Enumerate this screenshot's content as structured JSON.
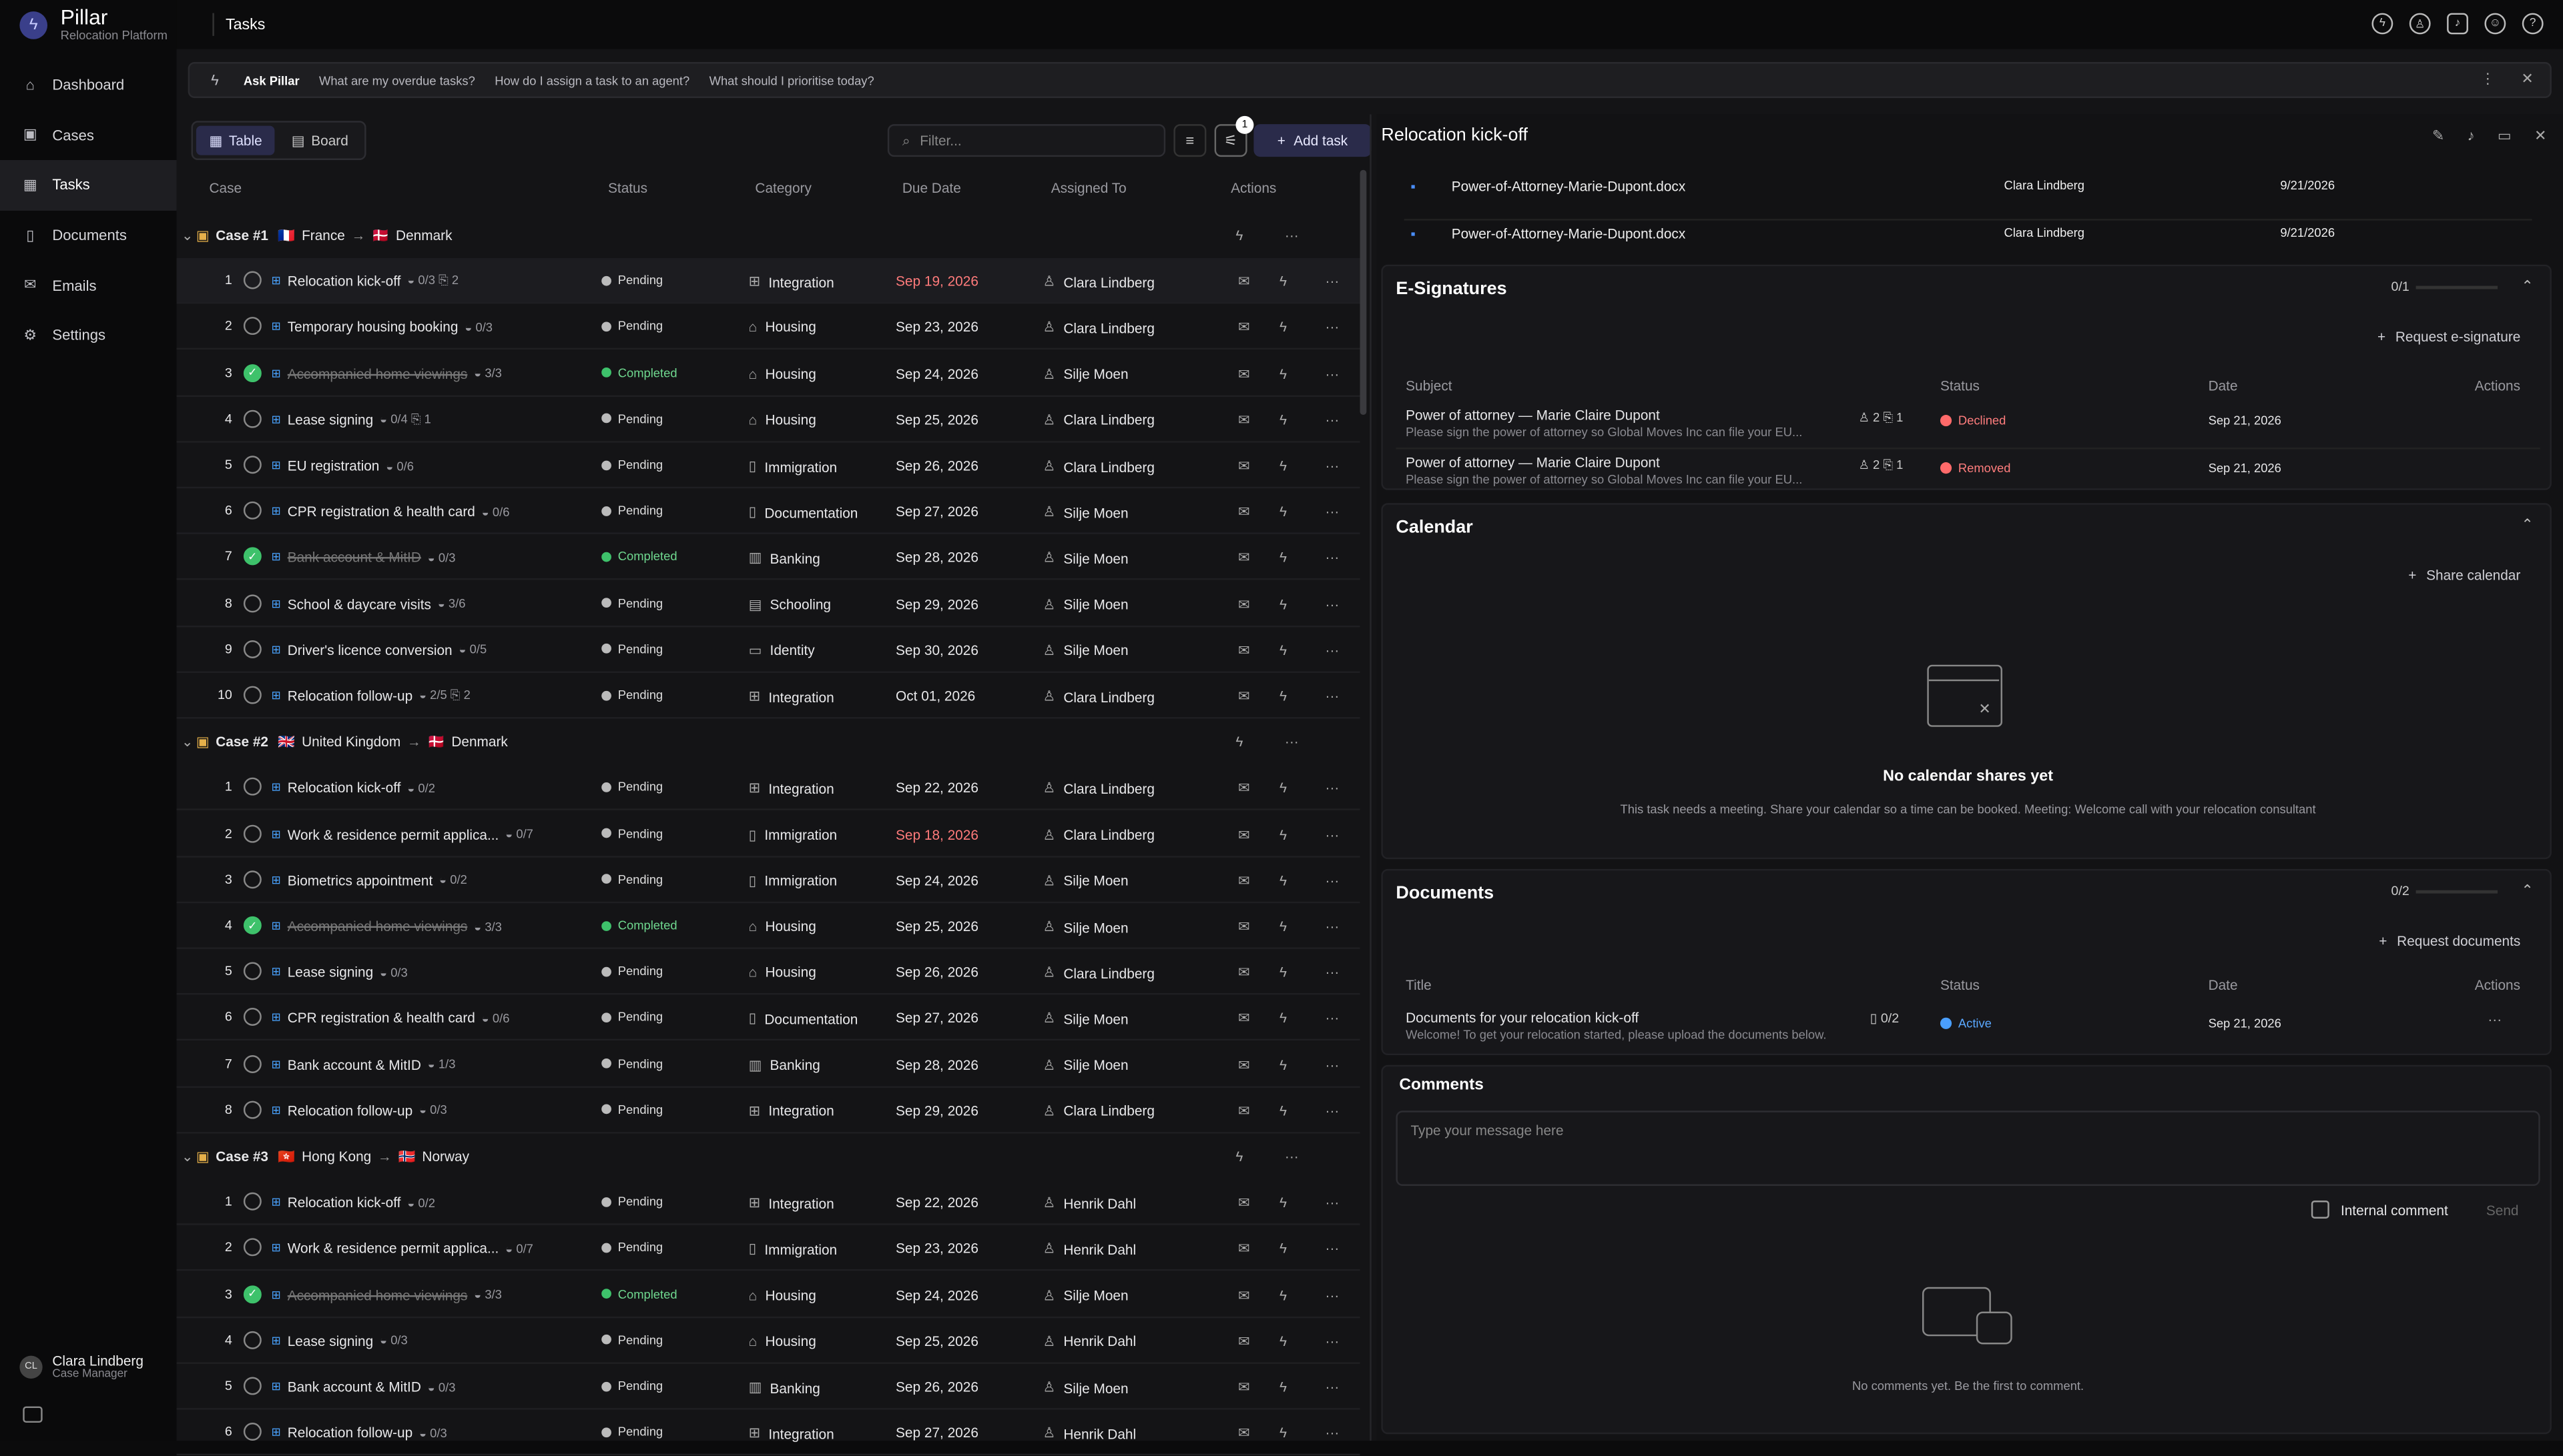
{
  "app": {
    "name": "Pillar",
    "subtitle": "Relocation Platform",
    "page_title": "Tasks"
  },
  "nav": [
    {
      "label": "Dashboard",
      "icon": "dashboard-icon"
    },
    {
      "label": "Cases",
      "icon": "briefcase-icon"
    },
    {
      "label": "Tasks",
      "icon": "tasks-icon",
      "active": true
    },
    {
      "label": "Documents",
      "icon": "document-icon"
    },
    {
      "label": "Emails",
      "icon": "mail-icon"
    },
    {
      "label": "Settings",
      "icon": "gear-icon"
    }
  ],
  "user": {
    "name": "Clara Lindberg",
    "role": "Case Manager",
    "initials": "CL"
  },
  "ask": {
    "title": "Ask Pillar",
    "suggestions": [
      "What are my overdue tasks?",
      "How do I assign a task to an agent?",
      "What should I prioritise today?"
    ]
  },
  "toolbar": {
    "view_table": "Table",
    "view_board": "Board",
    "filter_placeholder": "Filter...",
    "filter_badge": "1",
    "add_task": "Add task"
  },
  "columns": {
    "case": "Case",
    "status": "Status",
    "category": "Category",
    "due": "Due Date",
    "assigned": "Assigned To",
    "actions": "Actions"
  },
  "cases": [
    {
      "label": "Case #1",
      "from_flag": "🇫🇷",
      "from": "France",
      "to_flag": "🇩🇰",
      "to": "Denmark",
      "tasks": [
        {
          "n": "1",
          "name": "Relocation kick-off",
          "meta": "◒ 0/3  ⎘ 2",
          "status": "Pending",
          "category": "Integration",
          "due": "Sep 19, 2026",
          "over": true,
          "assignee": "Clara Lindberg",
          "sel": true
        },
        {
          "n": "2",
          "name": "Temporary housing booking",
          "meta": "◒ 0/3",
          "status": "Pending",
          "category": "Housing",
          "due": "Sep 23, 2026",
          "assignee": "Clara Lindberg"
        },
        {
          "n": "3",
          "name": "Accompanied home viewings",
          "meta": "◒ 3/3",
          "status": "Completed",
          "done": true,
          "category": "Housing",
          "due": "Sep 24, 2026",
          "assignee": "Silje Moen"
        },
        {
          "n": "4",
          "name": "Lease signing",
          "meta": "◒ 0/4  ⎘ 1",
          "status": "Pending",
          "category": "Housing",
          "due": "Sep 25, 2026",
          "assignee": "Clara Lindberg"
        },
        {
          "n": "5",
          "name": "EU registration",
          "meta": "◒ 0/6",
          "status": "Pending",
          "category": "Immigration",
          "due": "Sep 26, 2026",
          "assignee": "Clara Lindberg"
        },
        {
          "n": "6",
          "name": "CPR registration & health card",
          "meta": "◒ 0/6",
          "status": "Pending",
          "category": "Documentation",
          "due": "Sep 27, 2026",
          "assignee": "Silje Moen"
        },
        {
          "n": "7",
          "name": "Bank account & MitID",
          "meta": "◒ 0/3",
          "status": "Completed",
          "done": true,
          "category": "Banking",
          "due": "Sep 28, 2026",
          "assignee": "Silje Moen"
        },
        {
          "n": "8",
          "name": "School & daycare visits",
          "meta": "◒ 3/6",
          "status": "Pending",
          "category": "Schooling",
          "due": "Sep 29, 2026",
          "assignee": "Silje Moen"
        },
        {
          "n": "9",
          "name": "Driver's licence conversion",
          "meta": "◒ 0/5",
          "status": "Pending",
          "category": "Identity",
          "due": "Sep 30, 2026",
          "assignee": "Silje Moen"
        },
        {
          "n": "10",
          "name": "Relocation follow-up",
          "meta": "◒ 2/5  ⎘ 2",
          "status": "Pending",
          "category": "Integration",
          "due": "Oct 01, 2026",
          "assignee": "Clara Lindberg"
        }
      ]
    },
    {
      "label": "Case #2",
      "from_flag": "🇬🇧",
      "from": "United Kingdom",
      "to_flag": "🇩🇰",
      "to": "Denmark",
      "tasks": [
        {
          "n": "1",
          "name": "Relocation kick-off",
          "meta": "◒ 0/2",
          "status": "Pending",
          "category": "Integration",
          "due": "Sep 22, 2026",
          "assignee": "Clara Lindberg"
        },
        {
          "n": "2",
          "name": "Work & residence permit applica...",
          "meta": "◒ 0/7",
          "status": "Pending",
          "category": "Immigration",
          "due": "Sep 18, 2026",
          "over": true,
          "assignee": "Clara Lindberg"
        },
        {
          "n": "3",
          "name": "Biometrics appointment",
          "meta": "◒ 0/2",
          "status": "Pending",
          "category": "Immigration",
          "due": "Sep 24, 2026",
          "assignee": "Silje Moen"
        },
        {
          "n": "4",
          "name": "Accompanied home viewings",
          "meta": "◒ 3/3",
          "status": "Completed",
          "done": true,
          "category": "Housing",
          "due": "Sep 25, 2026",
          "assignee": "Silje Moen"
        },
        {
          "n": "5",
          "name": "Lease signing",
          "meta": "◒ 0/3",
          "status": "Pending",
          "category": "Housing",
          "due": "Sep 26, 2026",
          "assignee": "Clara Lindberg"
        },
        {
          "n": "6",
          "name": "CPR registration & health card",
          "meta": "◒ 0/6",
          "status": "Pending",
          "category": "Documentation",
          "due": "Sep 27, 2026",
          "assignee": "Silje Moen"
        },
        {
          "n": "7",
          "name": "Bank account & MitID",
          "meta": "◒ 1/3",
          "status": "Pending",
          "category": "Banking",
          "due": "Sep 28, 2026",
          "assignee": "Silje Moen"
        },
        {
          "n": "8",
          "name": "Relocation follow-up",
          "meta": "◒ 0/3",
          "status": "Pending",
          "category": "Integration",
          "due": "Sep 29, 2026",
          "assignee": "Clara Lindberg"
        }
      ]
    },
    {
      "label": "Case #3",
      "from_flag": "🇭🇰",
      "from": "Hong Kong",
      "to_flag": "🇳🇴",
      "to": "Norway",
      "tasks": [
        {
          "n": "1",
          "name": "Relocation kick-off",
          "meta": "◒ 0/2",
          "status": "Pending",
          "category": "Integration",
          "due": "Sep 22, 2026",
          "assignee": "Henrik Dahl"
        },
        {
          "n": "2",
          "name": "Work & residence permit applica...",
          "meta": "◒ 0/7",
          "status": "Pending",
          "category": "Immigration",
          "due": "Sep 23, 2026",
          "assignee": "Henrik Dahl"
        },
        {
          "n": "3",
          "name": "Accompanied home viewings",
          "meta": "◒ 3/3",
          "status": "Completed",
          "done": true,
          "category": "Housing",
          "due": "Sep 24, 2026",
          "assignee": "Silje Moen"
        },
        {
          "n": "4",
          "name": "Lease signing",
          "meta": "◒ 0/3",
          "status": "Pending",
          "category": "Housing",
          "due": "Sep 25, 2026",
          "assignee": "Henrik Dahl"
        },
        {
          "n": "5",
          "name": "Bank account & MitID",
          "meta": "◒ 0/3",
          "status": "Pending",
          "category": "Banking",
          "due": "Sep 26, 2026",
          "assignee": "Silje Moen"
        },
        {
          "n": "6",
          "name": "Relocation follow-up",
          "meta": "◒ 0/3",
          "status": "Pending",
          "category": "Integration",
          "due": "Sep 27, 2026",
          "assignee": "Henrik Dahl"
        }
      ]
    }
  ],
  "detail": {
    "title": "Relocation kick-off",
    "files": [
      {
        "name": "Power-of-Attorney-Marie-Dupont.docx",
        "owner": "Clara Lindberg",
        "date": "9/21/2026"
      },
      {
        "name": "Power-of-Attorney-Marie-Dupont.docx",
        "owner": "Clara Lindberg",
        "date": "9/21/2026"
      }
    ],
    "esign": {
      "title": "E-Signatures",
      "progress": "0/1",
      "request": "Request e-signature",
      "cols": [
        "Subject",
        "Status",
        "Date",
        "Actions"
      ],
      "rows": [
        {
          "subject": "Power of attorney — Marie Claire Dupont",
          "sub": "Please sign the power of attorney so Global Moves Inc can file your EU...",
          "counts": "♙ 2  ⎘ 1",
          "status": "Declined",
          "date": "Sep 21, 2026"
        },
        {
          "subject": "Power of attorney — Marie Claire Dupont",
          "sub": "Please sign the power of attorney so Global Moves Inc can file your EU...",
          "counts": "♙ 2  ⎘ 1",
          "status": "Removed",
          "date": "Sep 21, 2026"
        }
      ]
    },
    "calendar": {
      "title": "Calendar",
      "share": "Share calendar",
      "empty_title": "No calendar shares yet",
      "empty_text": "This task needs a meeting. Share your calendar so a time can be booked. Meeting: Welcome call with your relocation consultant"
    },
    "documents": {
      "title": "Documents",
      "progress": "0/2",
      "request": "Request documents",
      "cols": [
        "Title",
        "Status",
        "Date",
        "Actions"
      ],
      "row": {
        "title": "Documents for your relocation kick-off",
        "sub": "Welcome! To get your relocation started, please upload the documents below.",
        "count": "0/2",
        "status": "Active",
        "date": "Sep 21, 2026"
      }
    },
    "comments": {
      "title": "Comments",
      "placeholder": "Type your message here",
      "internal": "Internal comment",
      "send": "Send",
      "empty": "No comments yet. Be the first to comment."
    }
  }
}
